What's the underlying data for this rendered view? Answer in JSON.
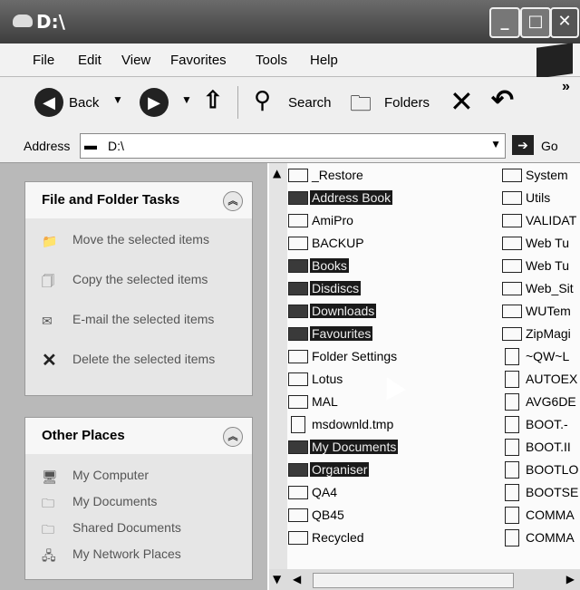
{
  "window": {
    "title": "D:\\"
  },
  "menu": {
    "items": [
      "File",
      "Edit",
      "View",
      "Favorites",
      "Tools",
      "Help"
    ]
  },
  "toolbar": {
    "back": "Back",
    "search": "Search",
    "folders": "Folders",
    "more": "»"
  },
  "address": {
    "label": "Address",
    "value": "D:\\",
    "go": "Go"
  },
  "tasks": {
    "title": "File and Folder Tasks",
    "items": [
      "Move the selected items",
      "Copy the selected items",
      "E-mail the selected items",
      "Delete the selected items"
    ]
  },
  "other_places": {
    "title": "Other Places",
    "items": [
      "My Computer",
      "My Documents",
      "Shared Documents",
      "My Network Places"
    ]
  },
  "files_col1": [
    {
      "name": "_Restore",
      "selected": false
    },
    {
      "name": "Address Book",
      "selected": true
    },
    {
      "name": "AmiPro",
      "selected": false
    },
    {
      "name": "BACKUP",
      "selected": false
    },
    {
      "name": "Books",
      "selected": true
    },
    {
      "name": "Disdiscs",
      "selected": true
    },
    {
      "name": "Downloads",
      "selected": true
    },
    {
      "name": "Favourites",
      "selected": true
    },
    {
      "name": "Folder Settings",
      "selected": false
    },
    {
      "name": "Lotus",
      "selected": false
    },
    {
      "name": "MAL",
      "selected": false
    },
    {
      "name": "msdownld.tmp",
      "selected": false
    },
    {
      "name": "My Documents",
      "selected": true
    },
    {
      "name": "Organiser",
      "selected": true
    },
    {
      "name": "QA4",
      "selected": false
    },
    {
      "name": "QB45",
      "selected": false
    },
    {
      "name": "Recycled",
      "selected": false
    }
  ],
  "files_col2": [
    "System",
    "Utils",
    "VALIDAT",
    "Web Tu",
    "Web Tu",
    "Web_Sit",
    "WUTem",
    "ZipMagi",
    "~QW~L",
    "AUTOEX",
    "AVG6DE",
    "BOOT.-",
    "BOOT.II",
    "BOOTLO",
    "BOOTSE",
    "COMMA",
    "COMMA"
  ],
  "colors": {
    "selection": "#1a1a1a",
    "panel": "#e6e6e6",
    "left_bg": "#b9b9b9"
  }
}
